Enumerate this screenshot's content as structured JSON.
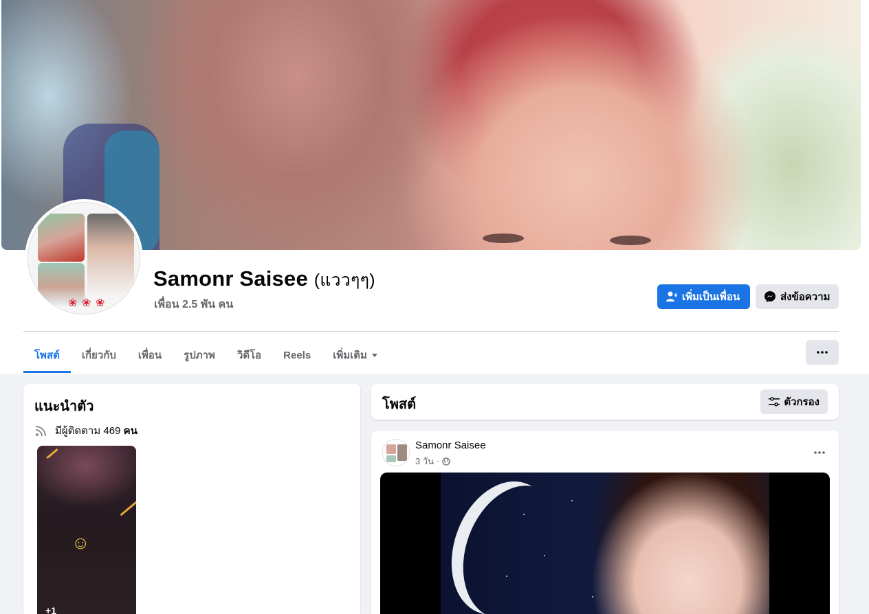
{
  "profile": {
    "name": "Samonr Saisee",
    "alternate_name": "(แววๆๆ)",
    "friends_count": "เพื่อน 2.5 พัน คน"
  },
  "actions": {
    "add_friend": "เพิ่มเป็นเพื่อน",
    "message": "ส่งข้อความ"
  },
  "tabs": [
    {
      "label": "โพสต์",
      "active": true
    },
    {
      "label": "เกี่ยวกับ",
      "active": false
    },
    {
      "label": "เพื่อน",
      "active": false
    },
    {
      "label": "รูปภาพ",
      "active": false
    },
    {
      "label": "วิดีโอ",
      "active": false
    },
    {
      "label": "Reels",
      "active": false
    },
    {
      "label": "เพิ่มเติม",
      "active": false
    }
  ],
  "intro": {
    "title": "แนะนำตัว",
    "followers_prefix": "มีผู้ติดตาม 469",
    "followers_suffix": "คน",
    "featured_more": "+1"
  },
  "posts": {
    "title": "โพสต์",
    "filter_label": "ตัวกรอง"
  },
  "post": {
    "author": "Samonr Saisee",
    "time": "3 วัน ·"
  },
  "colors": {
    "accent": "#1b74e4",
    "secondary_button": "#e4e6eb",
    "page_bg": "#f0f2f5"
  },
  "icons": {
    "add_friend": "person-plus-icon",
    "message": "messenger-icon",
    "more": "ellipsis-icon",
    "filter": "sliders-icon",
    "followers": "rss-icon",
    "privacy": "globe-icon",
    "tab_more": "caret-down-icon"
  }
}
